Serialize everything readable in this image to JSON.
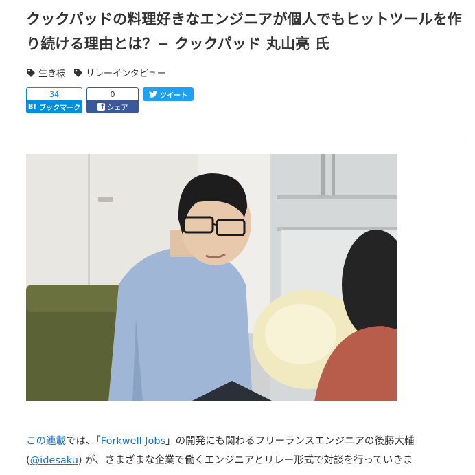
{
  "article": {
    "title": "クックパッドの料理好きなエンジニアが個人でもヒットツールを作り続ける理由とは？− クックパッド 丸山亮 氏",
    "tags": [
      "生き様",
      "リレーインタビュー"
    ]
  },
  "share": {
    "hatena": {
      "count": "34",
      "label": "ブックマーク",
      "mark": "B!"
    },
    "facebook": {
      "count": "0",
      "label": "シェア",
      "mark": "f"
    },
    "twitter": {
      "label": "ツイート"
    }
  },
  "body": {
    "link_series": "この連載",
    "text_1": "では、「",
    "link_forkwell": "Forkwell Jobs",
    "text_2": "」の開発にも関わるフリーランスエンジニアの後藤大輔",
    "text_3": "(",
    "link_handle": "@idesaku",
    "text_4": ") が、さまざまな企業で働くエンジニアとリレー形式で対談を行っていきま"
  },
  "colors": {
    "hatena": "#008fde",
    "facebook": "#3b5998",
    "twitter": "#1da1f2",
    "link": "#1a73c8"
  }
}
